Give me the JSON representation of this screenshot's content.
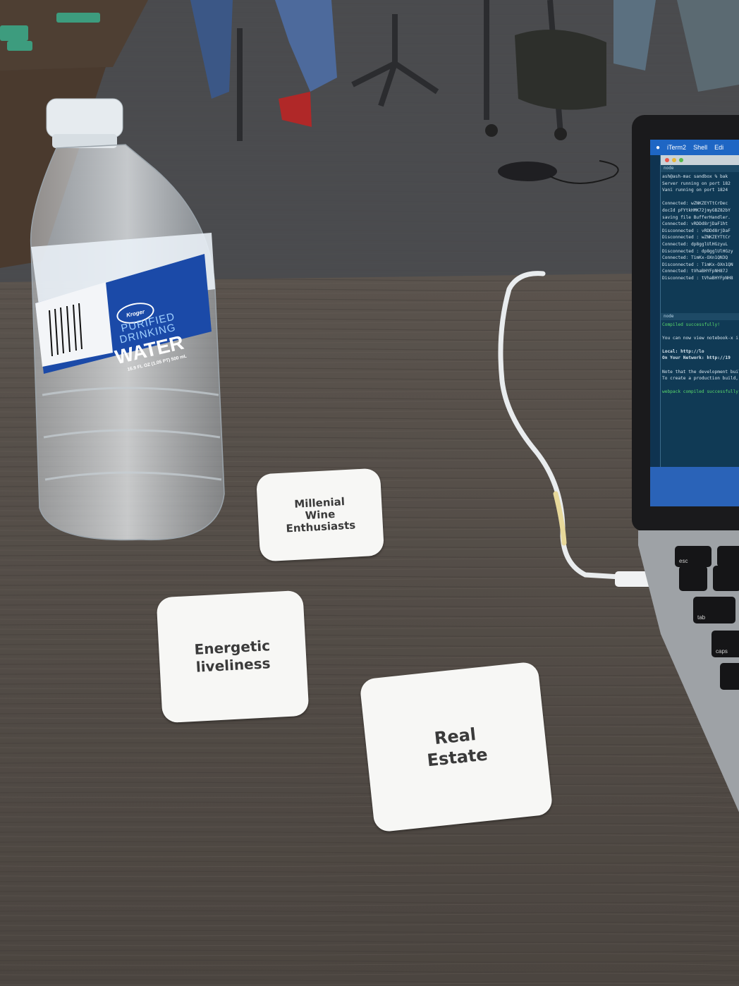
{
  "scene": {
    "background_colors": {
      "carpet": "#4a4b4e",
      "table": "#57504a",
      "card": "#f7f7f5",
      "bottle_label": "#1b4aa8"
    }
  },
  "bottle_label": {
    "brand": "Kroger",
    "line1": "PURIFIED",
    "line2": "DRINKING",
    "line3": "WATER",
    "line4": "16.9 FL OZ (1.05 PT) 500 mL"
  },
  "cards": [
    {
      "text": "Millenial\nWine\nEnthusiasts"
    },
    {
      "text": "Energetic\nliveliness"
    },
    {
      "text": "Real\nEstate"
    }
  ],
  "laptop": {
    "menubar": {
      "app": "iTerm2",
      "menu1": "Shell",
      "menu2": "Edi"
    },
    "top_pane_tab": "node",
    "bottom_pane_tab": "node",
    "top_pane_lines": [
      "ash@ash-mac sandbox % bak",
      "Server running on port 182",
      "Vani running on port 1824",
      "",
      "Connected:  wZNKZEYTtCrDec",
      "docId pFYtkHMK72jmyGBZ82bY",
      "saving file BufferHandler.",
      "Connected:  vRDDd8rjDaF1ht",
      "Disconnected : vRDDd8rjDaF",
      "Disconnected : wZNKZEYTtCr",
      "Connected:  dp8gglUlHGzyuL",
      "Disconnected : dp8gglUlHGzy",
      "Connected:  TimKx-OXn1QN3Q",
      "Disconnected : TimKx-OXn1QN",
      "Connected:  tVhaBHYFpNH87J",
      "Disconnected : tVhaBHYFpNH8"
    ],
    "bottom_pane_lines": [
      "Compiled successfully!",
      "",
      "You can now view notebook-x i",
      "",
      "  Local:          http://lo",
      "  On Your Network:  http://19",
      "",
      "Note that the development buil",
      "To create a production build,",
      "",
      "webpack compiled successfully"
    ],
    "keys": [
      "esc",
      "tab",
      "caps"
    ]
  }
}
